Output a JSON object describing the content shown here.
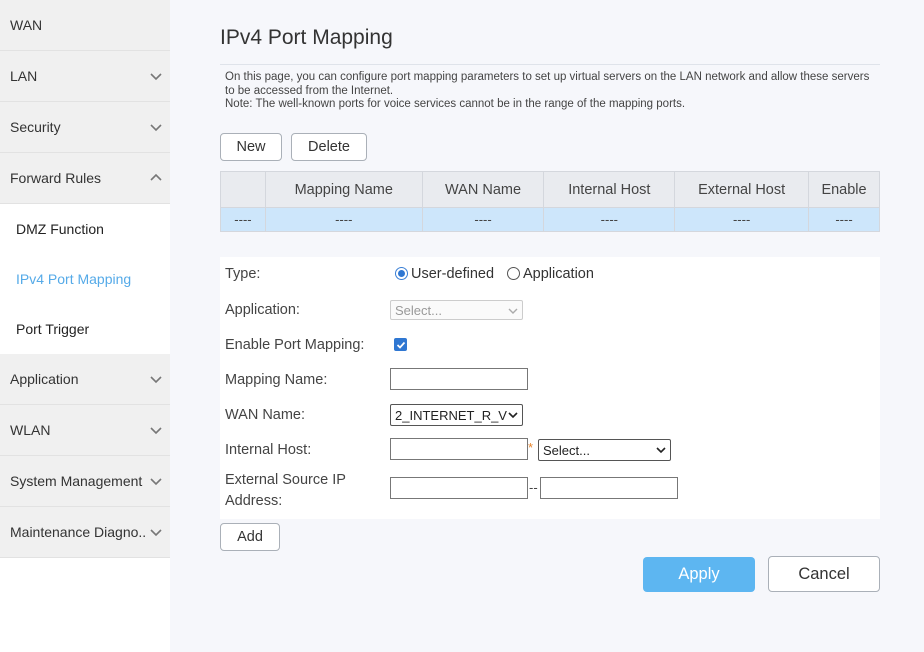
{
  "sidebar": {
    "items": [
      {
        "label": "WAN"
      },
      {
        "label": "LAN"
      },
      {
        "label": "Security"
      },
      {
        "label": "Forward Rules"
      },
      {
        "label": "Application"
      },
      {
        "label": "WLAN"
      },
      {
        "label": "System Management"
      },
      {
        "label": "Maintenance Diagno.."
      }
    ],
    "sub_items": [
      {
        "label": "DMZ Function"
      },
      {
        "label": "IPv4 Port Mapping",
        "active": true
      },
      {
        "label": "Port Trigger"
      }
    ]
  },
  "main": {
    "title": "IPv4 Port Mapping",
    "description_1": "On this page, you can configure port mapping parameters to set up virtual servers on the LAN network and allow these servers to be accessed from the Internet.",
    "description_2": "Note: The well-known ports for voice services cannot be in the range of the mapping ports.",
    "buttons": {
      "new": "New",
      "delete": "Delete",
      "add": "Add",
      "apply": "Apply",
      "cancel": "Cancel"
    },
    "table": {
      "headers": [
        "",
        "Mapping Name",
        "WAN Name",
        "Internal Host",
        "External Host",
        "Enable"
      ],
      "row": [
        "----",
        "----",
        "----",
        "----",
        "----",
        "----"
      ]
    },
    "form": {
      "type_label": "Type:",
      "type_option_1": "User-defined",
      "type_option_2": "Application",
      "application_label": "Application:",
      "application_select": "Select...",
      "enable_label": "Enable Port Mapping:",
      "enable_checked": true,
      "mapping_name_label": "Mapping Name:",
      "mapping_name_value": "",
      "wan_name_label": "WAN Name:",
      "wan_name_select": "2_INTERNET_R_V",
      "internal_host_label": "Internal Host:",
      "internal_host_value": "",
      "required_mark": "*",
      "internal_host_select": "Select...",
      "external_ip_label_1": "External Source IP",
      "external_ip_label_2": "Address:",
      "range_separator": "--"
    },
    "colors": {
      "accent": "#5db6f1",
      "active_nav": "#55aae8",
      "row_highlight": "#cde6fb",
      "required": "#e8842a"
    }
  }
}
